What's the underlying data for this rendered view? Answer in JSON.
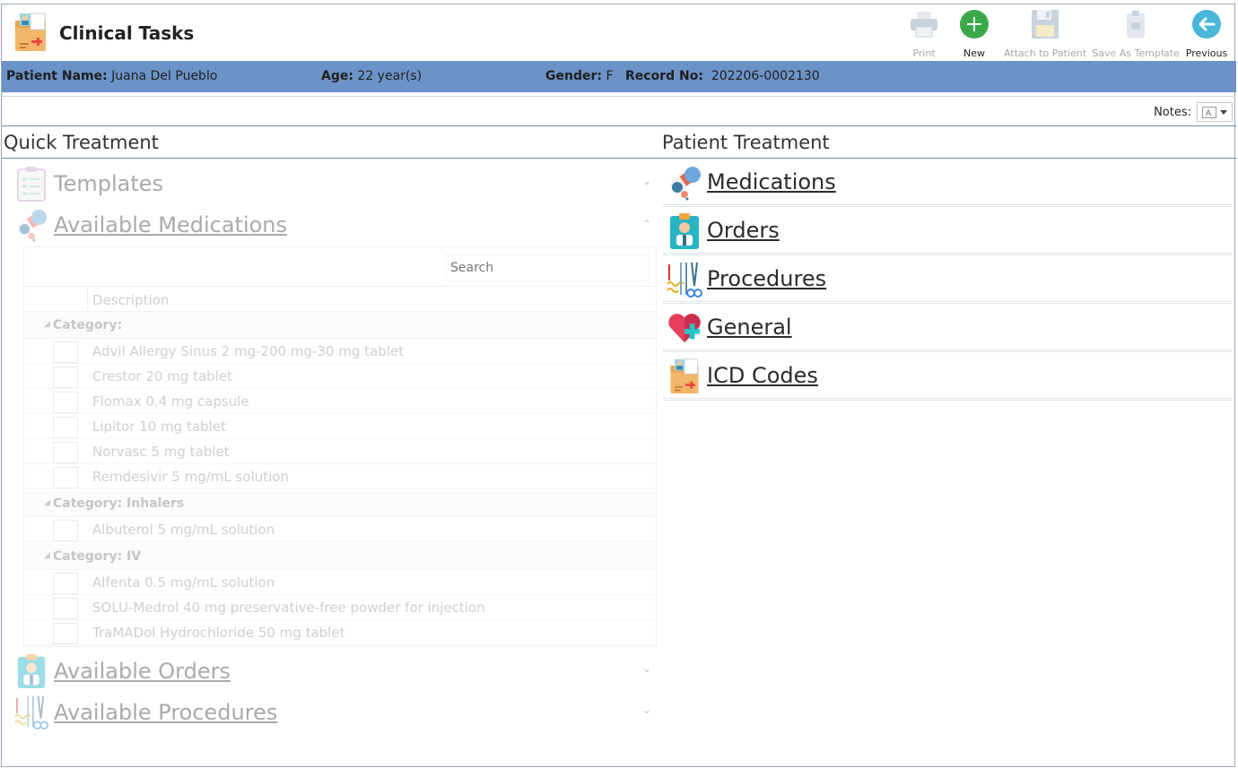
{
  "app": {
    "title": "Clinical Tasks"
  },
  "toolbar": {
    "print_label": "Print",
    "new_label": "New",
    "attach_label": "Attach to Patient",
    "save_template_label": "Save As Template",
    "previous_label": "Previous"
  },
  "patient": {
    "name_label": "Patient Name:",
    "name": "Juana Del Pueblo",
    "age_label": "Age:",
    "age": "22 year(s)",
    "gender_label": "Gender:",
    "gender": "F",
    "record_label": "Record No:",
    "record": "202206-0002130"
  },
  "notes": {
    "label": "Notes:"
  },
  "quick_treatment": {
    "title": "Quick Treatment",
    "templates_label": "Templates",
    "available_medications_label": "Available Medications",
    "search_placeholder": "Search",
    "description_header": "Description",
    "categories": [
      {
        "label": "Category:",
        "items": [
          "Advil Allergy Sinus 2 mg-200 mg-30 mg tablet",
          "Crestor 20 mg tablet",
          "Flomax 0.4 mg capsule",
          "Lipitor 10 mg tablet",
          "Norvasc 5 mg tablet",
          "Remdesivir 5 mg/mL solution"
        ]
      },
      {
        "label": "Category: Inhalers",
        "items": [
          "Albuterol 5 mg/mL solution"
        ]
      },
      {
        "label": "Category: IV",
        "items": [
          "Alfenta 0.5 mg/mL solution",
          "SOLU-Medrol 40 mg preservative-free powder for injection",
          "TraMADol Hydrochloride 50 mg tablet"
        ]
      }
    ],
    "available_orders_label": "Available Orders",
    "available_procedures_label": "Available Procedures"
  },
  "patient_treatment": {
    "title": "Patient Treatment",
    "items": [
      {
        "label": "Medications",
        "icon": "pills-icon"
      },
      {
        "label": "Orders",
        "icon": "clipboard-doctor-icon"
      },
      {
        "label": "Procedures",
        "icon": "surgical-tools-icon"
      },
      {
        "label": "General",
        "icon": "heart-plus-icon"
      },
      {
        "label": "ICD Codes",
        "icon": "medical-folder-icon"
      }
    ]
  },
  "colors": {
    "patient_bar": "#6b93c8",
    "new_button": "#3aa84a",
    "previous_button": "#4ab6d8"
  }
}
